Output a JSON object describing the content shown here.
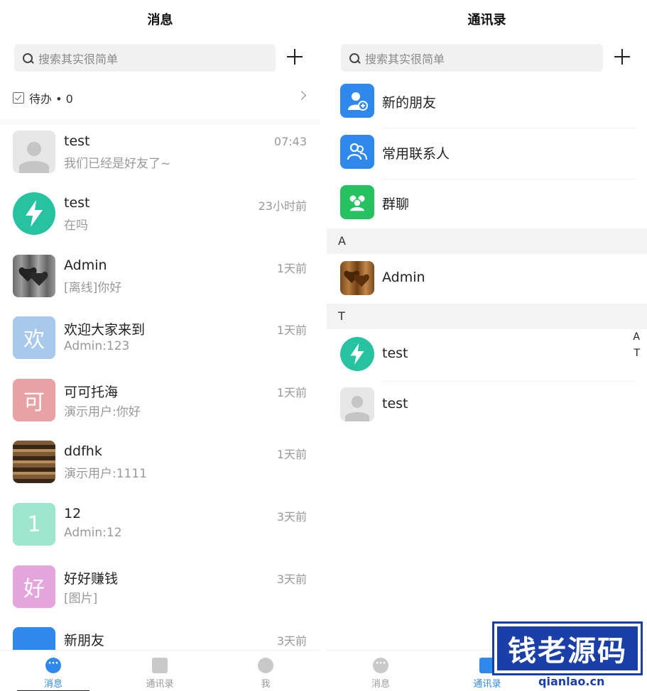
{
  "left": {
    "title": "消息",
    "search_placeholder": "搜索其实很简单",
    "todo_label": "待办 • 0",
    "chats": [
      {
        "name": "test",
        "message": "我们已经是好友了~",
        "time": "07:43",
        "avatar": "person-avatar"
      },
      {
        "name": "test",
        "message": "在吗",
        "time": "23小时前",
        "avatar": "bolt-avatar"
      },
      {
        "name": "Admin",
        "message": "[离线]你好",
        "time": "1天前",
        "avatar": "hearts-image"
      },
      {
        "name": "欢迎大家来到",
        "message": "Admin:123",
        "time": "1天前",
        "avatar_char": "欢",
        "avatar_color": "#a6c9ec"
      },
      {
        "name": "可可托海",
        "message": "演示用户:你好",
        "time": "1天前",
        "avatar_char": "可",
        "avatar_color": "#e8a2a3"
      },
      {
        "name": "ddfhk",
        "message": "演示用户:1111",
        "time": "1天前",
        "avatar": "food-image"
      },
      {
        "name": "12",
        "message": "Admin:12",
        "time": "3天前",
        "avatar_char": "1",
        "avatar_color": "#9fe6cf"
      },
      {
        "name": "好好赚钱",
        "message": "[图片]",
        "time": "3天前",
        "avatar_char": "好",
        "avatar_color": "#e4a5dc"
      },
      {
        "name": "新朋友",
        "message": "",
        "time": "3天前",
        "avatar": "blue-avatar"
      }
    ],
    "tabs": [
      {
        "label": "消息",
        "icon": "chat-bubble-icon",
        "active": true
      },
      {
        "label": "通讯录",
        "icon": "contacts-icon",
        "active": false
      },
      {
        "label": "我",
        "icon": "profile-icon",
        "active": false
      }
    ]
  },
  "right": {
    "title": "通讯录",
    "search_placeholder": "搜索其实很简单",
    "special": [
      {
        "label": "新的朋友",
        "icon": "add-friend-icon",
        "color": "#2f88ec"
      },
      {
        "label": "常用联系人",
        "icon": "frequent-contacts-icon",
        "color": "#2f88ec"
      },
      {
        "label": "群聊",
        "icon": "group-chat-icon",
        "color": "#26c160"
      }
    ],
    "sections": [
      {
        "letter": "A",
        "contacts": [
          {
            "name": "Admin",
            "avatar": "hearts-image"
          }
        ]
      },
      {
        "letter": "T",
        "contacts": [
          {
            "name": "test",
            "avatar": "bolt-avatar"
          },
          {
            "name": "test",
            "avatar": "person-avatar"
          }
        ]
      }
    ],
    "index_letters": [
      "A",
      "T"
    ],
    "tabs": [
      {
        "label": "消息",
        "icon": "chat-bubble-icon",
        "active": false
      },
      {
        "label": "通讯录",
        "icon": "contacts-icon",
        "active": true
      }
    ]
  },
  "watermark": {
    "text": "钱老源码",
    "url": "qianlao.cn"
  },
  "colors": {
    "accent": "#2f88ec",
    "green": "#26c160",
    "bolt": "#27c3a1"
  }
}
